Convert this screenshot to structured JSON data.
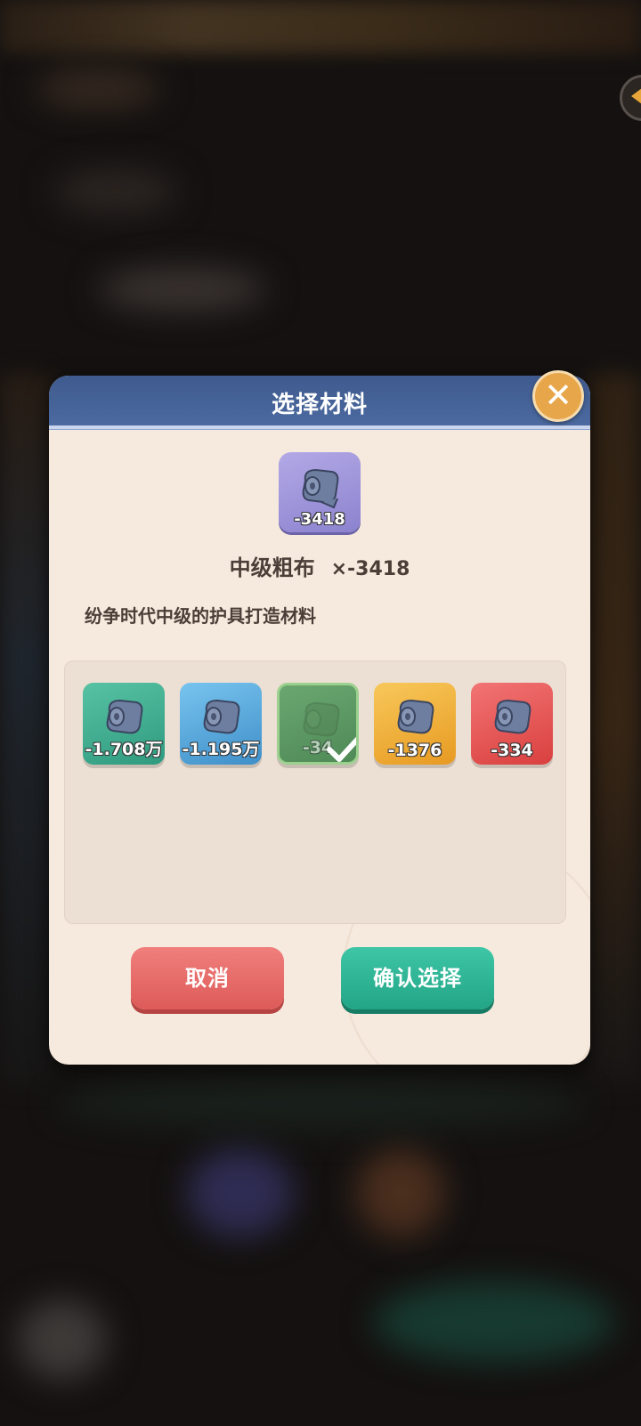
{
  "dialog": {
    "title": "选择材料",
    "close_icon": "close-icon"
  },
  "item": {
    "icon": "cloth-roll-icon",
    "count": "-3418",
    "name": "中级粗布",
    "multiplier": "×-3418",
    "description": "纷争时代中级的护具打造材料"
  },
  "materials": [
    {
      "count": "-1.708万",
      "color": "#3fae90"
    },
    {
      "count": "-1.195万",
      "color": "#5aa8dd"
    },
    {
      "count": "-34",
      "color": "#5f9966",
      "selected": true
    },
    {
      "count": "-1376",
      "color": "#efb03e"
    },
    {
      "count": "-334",
      "color": "#e75654"
    }
  ],
  "buttons": {
    "cancel": "取消",
    "confirm": "确认选择"
  }
}
